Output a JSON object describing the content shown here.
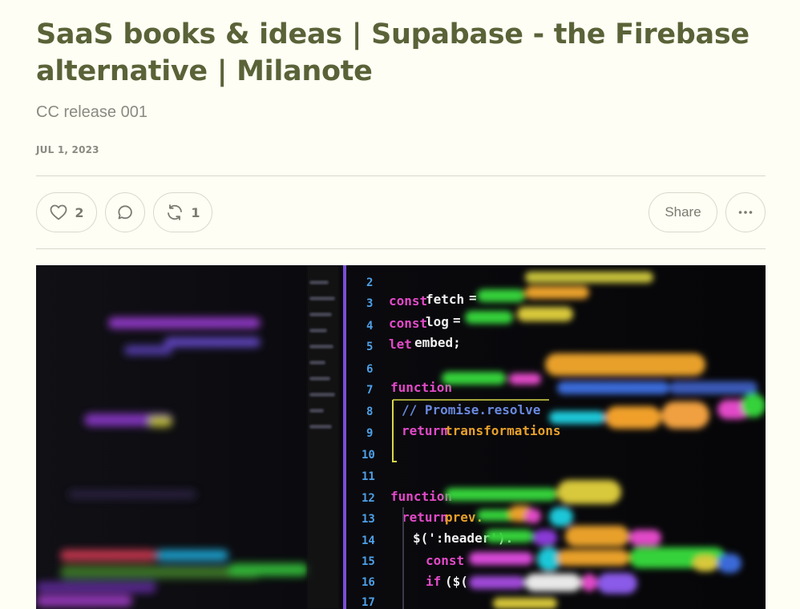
{
  "post": {
    "title": "SaaS books & ideas | Supabase - the Firebase alternative | Milanote",
    "subtitle": "CC release 001",
    "date": "JUL 1, 2023"
  },
  "actions": {
    "like_count": "2",
    "restack_count": "1",
    "share_label": "Share"
  },
  "hero_code": {
    "line_numbers": [
      "2",
      "3",
      "4",
      "5",
      "6",
      "7",
      "8",
      "9",
      "10",
      "11",
      "12",
      "13",
      "14",
      "15",
      "16",
      "17"
    ],
    "lines": [
      {
        "n": "3",
        "text": "const fetch = require('fetch-cookie')"
      },
      {
        "n": "4",
        "text": "const log = require('./log')"
      },
      {
        "n": "5",
        "text": "let embed;"
      },
      {
        "n": "7",
        "text": "function transform(t, ...transformations) {"
      },
      {
        "n": "8",
        "text": "// Promise.resolve is generally inefficient"
      },
      {
        "n": "9",
        "text": "return transformations.reduce((prev, current) => ...)"
      },
      {
        "n": "10",
        "text": "}"
      },
      {
        "n": "12",
        "text": "function removeLinkHeaders(prev) {"
      },
      {
        "n": "13",
        "text": "return prev.then($ => {"
      },
      {
        "n": "14",
        "text": "$(':header').each((i, header) => {"
      },
      {
        "n": "15",
        "text": "const children = $(header).children()"
      },
      {
        "n": "16",
        "text": "if ($(children).length ..."
      }
    ]
  },
  "icons": {
    "like": "heart-icon",
    "comment": "comment-bubble-icon",
    "restack": "restack-arrows-icon",
    "more": "ellipsis-icon"
  }
}
